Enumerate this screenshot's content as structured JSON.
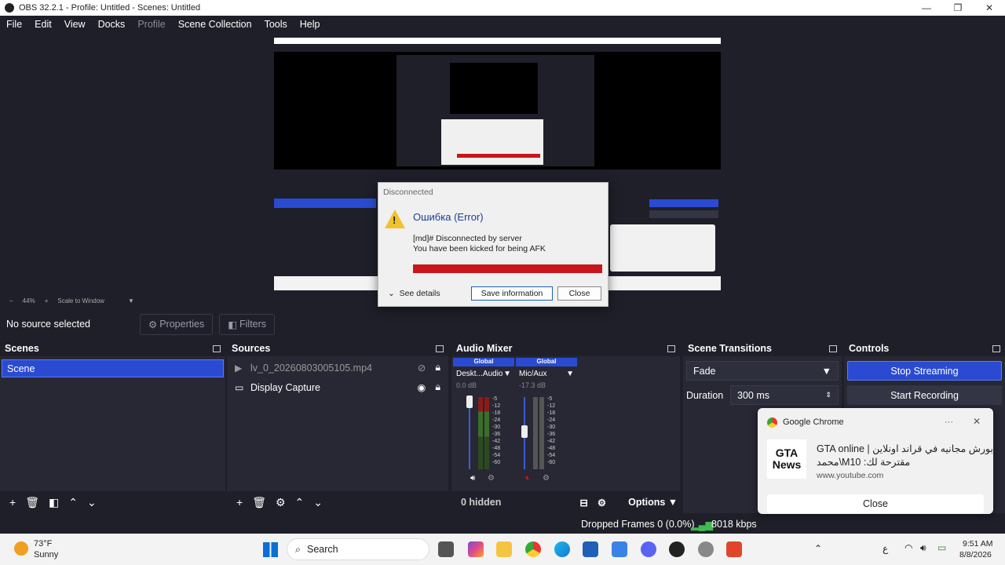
{
  "window": {
    "title": "OBS 32.2.1 - Profile: Untitled - Scenes: Untitled",
    "min": "—",
    "max": "❐",
    "close": "✕"
  },
  "menu": [
    "File",
    "Edit",
    "View",
    "Docks",
    "Profile",
    "Scene Collection",
    "Tools",
    "Help"
  ],
  "zoom": {
    "minus": "−",
    "percent": "44%",
    "plus": "+",
    "mode": "Scale to Window"
  },
  "source_bar": {
    "no_source": "No source selected",
    "properties": "Properties",
    "filters": "Filters"
  },
  "scenes": {
    "title": "Scenes",
    "items": [
      "Scene"
    ]
  },
  "sources": {
    "title": "Sources",
    "items": [
      {
        "icon": "play-icon",
        "label": "lv_0_20260803005105.mp4",
        "visible": false
      },
      {
        "icon": "monitor-icon",
        "label": "Display Capture",
        "visible": true
      }
    ]
  },
  "mixer": {
    "title": "Audio Mixer",
    "channels": [
      {
        "global": "Global",
        "name": "Deskt...Audio",
        "db": "0.0 dB",
        "level": 1.0
      },
      {
        "global": "Global",
        "name": "Mic/Aux",
        "db": "-17.3 dB",
        "level": 0.72
      }
    ],
    "scale": [
      "-5",
      "-12",
      "-18",
      "-24",
      "-30",
      "-36",
      "-42",
      "-48",
      "-54",
      "-60"
    ],
    "hidden": "0 hidden",
    "options": "Options"
  },
  "transitions": {
    "title": "Scene Transitions",
    "selected": "Fade",
    "duration_label": "Duration",
    "duration": "300 ms"
  },
  "controls": {
    "title": "Controls",
    "stop_streaming": "Stop Streaming",
    "start_recording": "Start Recording"
  },
  "status": {
    "dropped": "Dropped Frames 0 (0.0%)",
    "kbps": "8018 kbps"
  },
  "dialog": {
    "title": "Disconnected",
    "heading": "Ошибка (Error)",
    "line1": "[md]# Disconnected by server",
    "line2": "You have been kicked for being AFK",
    "see_details": "See details",
    "save": "Save information",
    "close": "Close"
  },
  "toast": {
    "app": "Google Chrome",
    "more": "···",
    "logo_line1": "GTA",
    "logo_line2": "News",
    "title": "GTA online | بورش مجانيه في قراند اونلاين",
    "subtitle": "محمد\\M10 :مقترحة لك",
    "source": "www.youtube.com",
    "close": "Close"
  },
  "taskbar": {
    "weather_temp": "73°F",
    "weather_desc": "Sunny",
    "search": "Search",
    "time": "9:51 AM",
    "date": "8/8/2026",
    "lang": "ع"
  },
  "colors": {
    "accent": "#2a4bd1",
    "error_red": "#c8161d",
    "warning_yellow": "#f2c12e"
  }
}
